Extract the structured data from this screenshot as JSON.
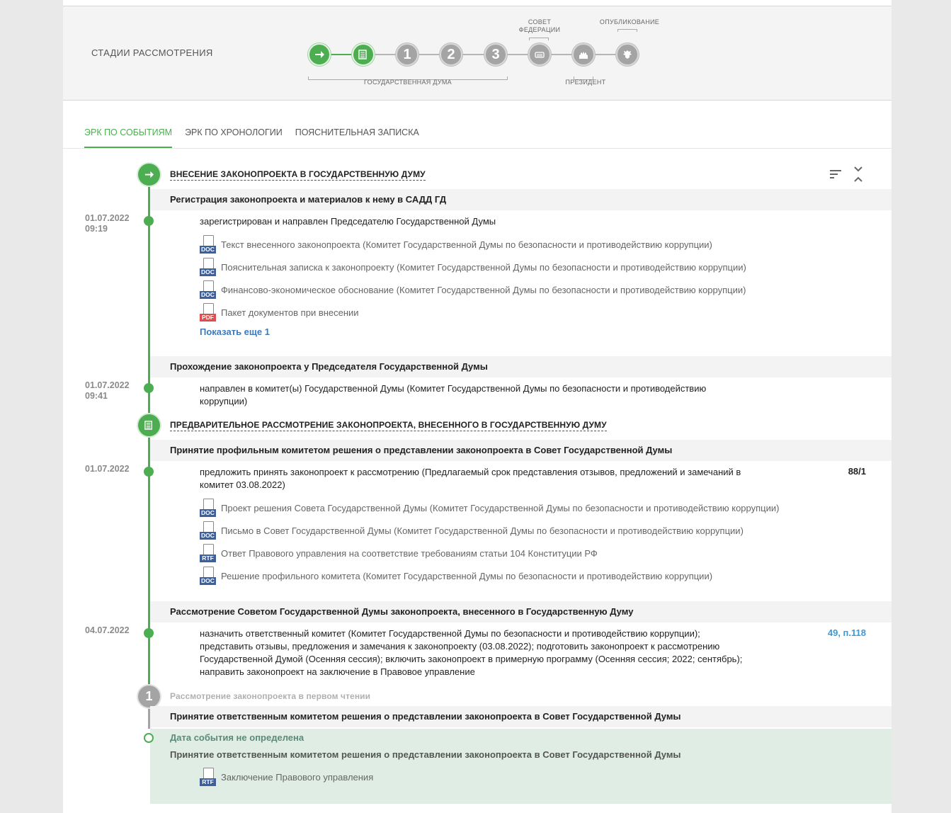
{
  "stages": {
    "title": "СТАДИИ РАССМОТРЕНИЯ",
    "items": [
      {
        "kind": "arrow",
        "active": true
      },
      {
        "kind": "doc",
        "active": true
      },
      {
        "kind": "num",
        "label": "1",
        "active": false
      },
      {
        "kind": "num",
        "label": "2",
        "active": false
      },
      {
        "kind": "num",
        "label": "3",
        "active": false
      },
      {
        "kind": "federation-council",
        "active": false
      },
      {
        "kind": "president",
        "active": false
      },
      {
        "kind": "emblem",
        "active": false
      }
    ],
    "caption_duma": "ГОСУДАРСТВЕННАЯ ДУМА",
    "caption_sovet": "СОВЕТ ФЕДЕРАЦИИ",
    "caption_president": "ПРЕЗИДЕНТ",
    "caption_publish": "ОПУБЛИКОВАНИЕ",
    "colors": {
      "active": "#4cae50",
      "inactive": "#a4a4a4"
    }
  },
  "tabs": [
    {
      "label": "ЭРК ПО СОБЫТИЯМ",
      "active": true
    },
    {
      "label": "ЭРК ПО ХРОНОЛОГИИ",
      "active": false
    },
    {
      "label": "ПОЯСНИТЕЛЬНАЯ ЗАПИСКА",
      "active": false
    }
  ],
  "timeline": {
    "stage1": {
      "title": "ВНЕСЕНИЕ ЗАКОНОПРОЕКТА В ГОСУДАРСТВЕННУЮ ДУМУ"
    },
    "event1": {
      "title": "Регистрация законопроекта и материалов к нему в САДД ГД",
      "date": "01.07.2022",
      "time": "09:19",
      "text": "зарегистрирован и направлен Председателю Государственной Думы",
      "docs": [
        {
          "type": "DOC",
          "label": "Текст внесенного законопроекта (Комитет Государственной Думы по безопасности и противодействию коррупции)"
        },
        {
          "type": "DOC",
          "label": "Пояснительная записка к законопроекту (Комитет Государственной Думы по безопасности и противодействию коррупции)"
        },
        {
          "type": "DOC",
          "label": "Финансово-экономическое обоснование (Комитет Государственной Думы по безопасности и противодействию коррупции)"
        },
        {
          "type": "PDF",
          "label": "Пакет документов при внесении"
        }
      ],
      "show_more": "Показать еще 1"
    },
    "event2": {
      "title": "Прохождение законопроекта у Председателя Государственной Думы",
      "date": "01.07.2022",
      "time": "09:41",
      "text_line1": "направлен в комитет(ы) Государственной Думы (Комитет Государственной Думы по безопасности и противодействию",
      "text_line2": "коррупции)"
    },
    "stage2": {
      "title": "ПРЕДВАРИТЕЛЬНОЕ РАССМОТРЕНИЕ ЗАКОНОПРОЕКТА, ВНЕСЕННОГО В ГОСУДАРСТВЕННУЮ ДУМУ"
    },
    "event3": {
      "title": "Принятие профильным комитетом решения о представлении законопроекта в Совет Государственной Думы",
      "date": "01.07.2022",
      "text_line1": "предложить принять законопроект к рассмотрению (Предлагаемый срок представления отзывов, предложений и замечаний в",
      "text_line2": "комитет 03.08.2022)",
      "number": "88/1",
      "docs": [
        {
          "type": "DOC",
          "label": "Проект решения Совета Государственной Думы (Комитет Государственной Думы по безопасности и противодействию коррупции)"
        },
        {
          "type": "DOC",
          "label": "Письмо в Совет Государственной Думы (Комитет Государственной Думы по безопасности и противодействию коррупции)"
        },
        {
          "type": "RTF",
          "label": "Ответ Правового управления на соответствие требованиям статьи 104 Конституции РФ"
        },
        {
          "type": "DOC",
          "label": "Решение профильного комитета (Комитет Государственной Думы по безопасности и противодействию коррупции)"
        }
      ]
    },
    "event4": {
      "title": "Рассмотрение Советом Государственной Думы законопроекта, внесенного в Государственную Думу",
      "date": "04.07.2022",
      "number": "49, п.118",
      "lines": [
        "назначить ответственный комитет (Комитет Государственной Думы по безопасности и противодействию коррупции);",
        "представить отзывы, предложения и замечания к законопроекту (03.08.2022); подготовить законопроект к рассмотрению",
        "Государственной Думой (Осенняя сессия); включить законопроект в примерную программу (Осенняя сессия; 2022; сентябрь);",
        "направить законопроект на заключение в Правовое управление"
      ]
    },
    "stage3": {
      "number": "1",
      "title": "Рассмотрение законопроекта в первом чтении"
    },
    "event5": {
      "title": "Принятие ответственным комитетом решения о представлении законопроекта в Совет Государственной Думы",
      "date_undefined": "Дата события не определена",
      "subtitle": "Принятие ответственным комитетом решения о представлении законопроекта в Совет Государственной Думы",
      "doc": {
        "type": "RTF",
        "label": "Заключение Правового управления"
      }
    }
  }
}
